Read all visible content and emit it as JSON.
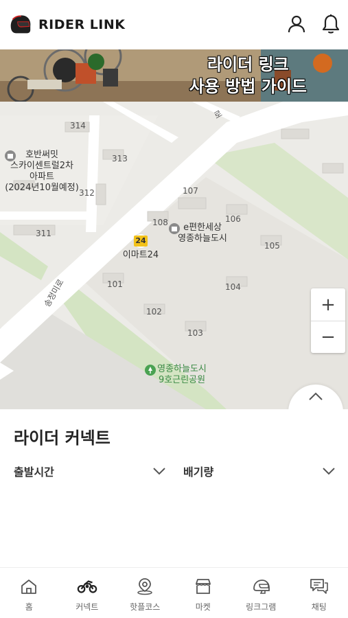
{
  "header": {
    "brand": "RIDER LINK",
    "profile_icon": "user-icon",
    "notification_icon": "bell-icon"
  },
  "banner": {
    "line1": "라이더 링크",
    "line2": "사용 방법 가이드"
  },
  "map": {
    "labels": {
      "l314": "314",
      "l313": "313",
      "l312": "312",
      "l311": "311",
      "l107": "107",
      "l108": "108",
      "l106": "106",
      "l105": "105",
      "l104": "104",
      "l101": "101",
      "l102": "102",
      "l103": "103",
      "road_top": "로",
      "road_side": "송정미로",
      "apt_line1": "호반써밋",
      "apt_line2": "스카이센트럴2차",
      "apt_line3": "아파트",
      "apt_line4": "(2024년10월예정)",
      "emart_badge": "24",
      "emart_name": "이마트24",
      "complex_line1": "e편한세상",
      "complex_line2": "영종하늘도시",
      "park_line1": "영종하늘도시",
      "park_line2": "9호근린공원"
    },
    "zoom_in": "+",
    "zoom_out": "−"
  },
  "panel": {
    "title": "라이더 커넥트",
    "filter_departure": "출발시간",
    "filter_displacement": "배기량"
  },
  "nav": {
    "items": [
      {
        "label": "홈",
        "icon": "home-icon"
      },
      {
        "label": "커넥트",
        "icon": "motorcycle-icon"
      },
      {
        "label": "핫플코스",
        "icon": "location-pin-icon"
      },
      {
        "label": "마켓",
        "icon": "store-icon"
      },
      {
        "label": "링크그램",
        "icon": "helmet-icon"
      },
      {
        "label": "채팅",
        "icon": "chat-icon"
      }
    ]
  }
}
